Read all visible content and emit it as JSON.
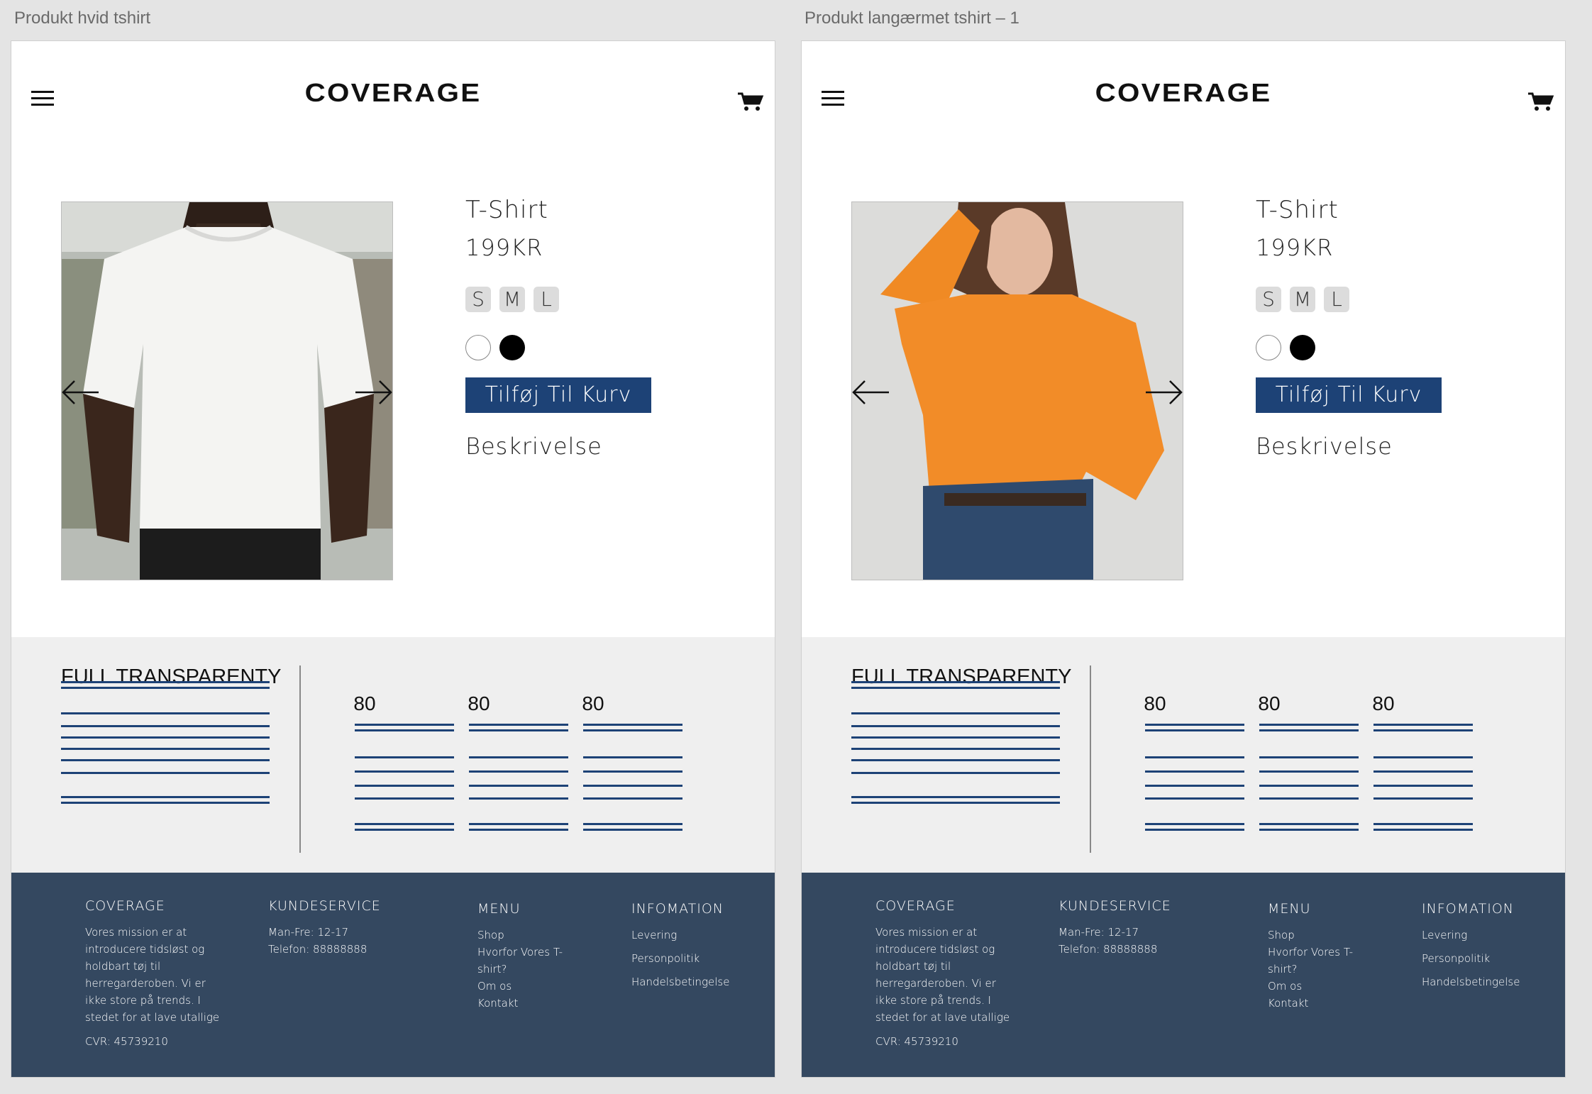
{
  "frames": [
    {
      "label": "Produkt hvid tshirt",
      "logo": "COVERAGE",
      "product": {
        "title": "T-Shirt",
        "price": "199KR",
        "sizes": [
          "S",
          "M",
          "L"
        ],
        "colors": [
          "#ffffff",
          "#000000"
        ],
        "add_to_cart": "Tilføj Til Kurv",
        "description_label": "Beskrivelse",
        "image": "white-tshirt-photo"
      },
      "transparency": {
        "title": "FULL TRANSPARENTY",
        "stats": [
          "80",
          "80",
          "80"
        ]
      }
    },
    {
      "label": "Produkt langærmet tshirt – 1",
      "logo": "COVERAGE",
      "product": {
        "title": "T-Shirt",
        "price": "199KR",
        "sizes": [
          "S",
          "M",
          "L"
        ],
        "colors": [
          "#ffffff",
          "#000000"
        ],
        "add_to_cart": "Tilføj Til Kurv",
        "description_label": "Beskrivelse",
        "image": "orange-longsleeve-photo"
      },
      "transparency": {
        "title": "FULL TRANSPARENTY",
        "stats": [
          "80",
          "80",
          "80"
        ]
      }
    }
  ],
  "footer": {
    "brand_head": "COVERAGE",
    "brand_text": [
      "Vores mission er at",
      "introducere tidsløst og",
      "holdbart tøj til",
      "herregarderoben. Vi er",
      "ikke store på trends. I",
      "stedet for at lave utallige"
    ],
    "cvr": "CVR: 45739210",
    "service_head": "KUNDESERVICE",
    "service_lines": [
      "Man-Fre: 12-17",
      "Telefon: 88888888"
    ],
    "menu_head": "MENU",
    "menu_items": [
      "Shop",
      "Hvorfor Vores T-",
      "shirt?",
      "Om os",
      "Kontakt"
    ],
    "info_head": "INFOMATION",
    "info_items": [
      "Levering",
      "Personpolitik",
      "Handelsbetingelse"
    ]
  },
  "colors": {
    "accent": "#1d4276",
    "footer_bg": "#344860",
    "section_bg": "#efefef",
    "canvas_bg": "#e4e4e4"
  }
}
